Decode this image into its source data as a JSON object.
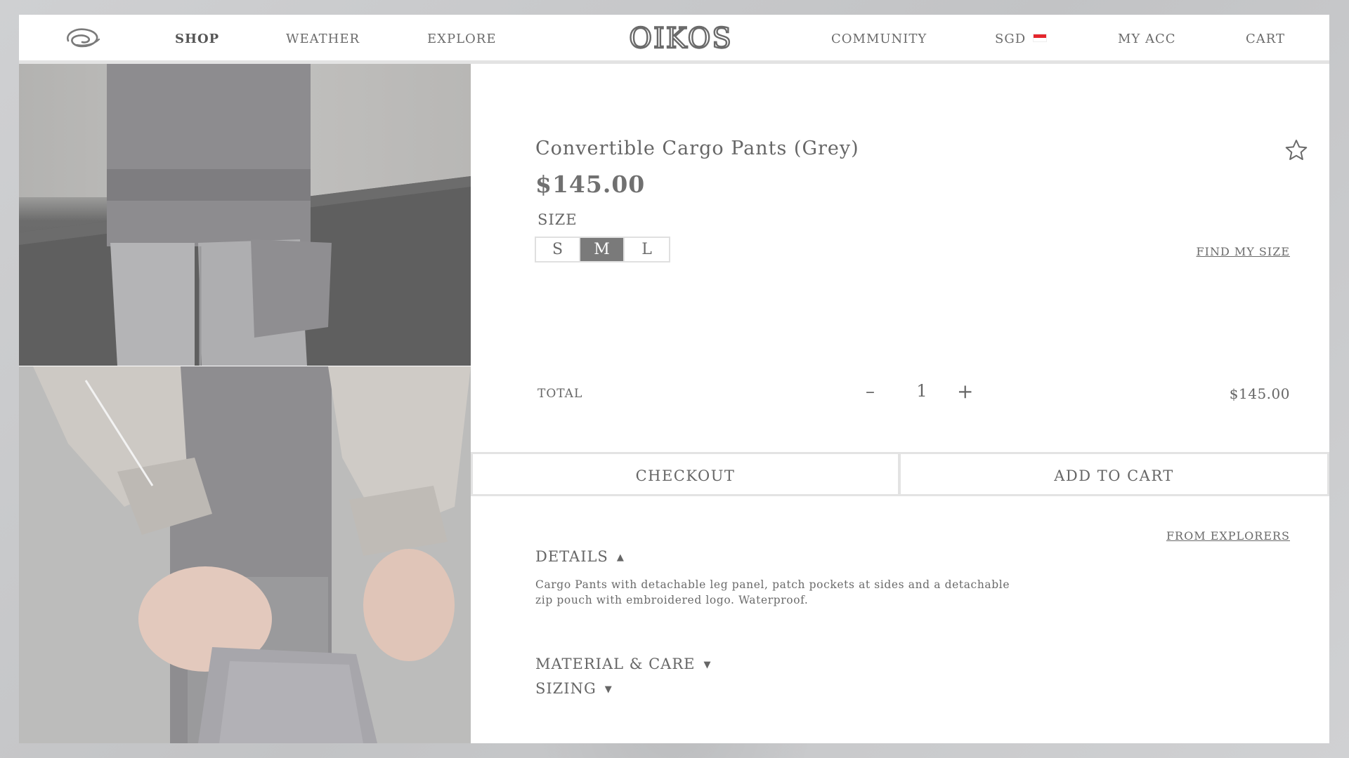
{
  "header": {
    "nav_left": [
      "SHOP",
      "WEATHER",
      "EXPLORE"
    ],
    "active_nav": "SHOP",
    "brand": "OIKOS",
    "nav_right": {
      "community": "COMMUNITY",
      "currency": "SGD",
      "account": "MY ACC",
      "cart": "CART"
    },
    "icons": {
      "logo": "swirl-logo-icon",
      "flag": "singapore-flag-icon"
    },
    "colors": {
      "text": "#6b6b6b",
      "active": "#555555"
    }
  },
  "gallery": {
    "images": [
      {
        "alt": "grey-cargo-pants-back-view",
        "icon": "product-photo"
      },
      {
        "alt": "detaching-leg-panel-closeup",
        "icon": "product-photo"
      }
    ]
  },
  "product": {
    "title": "Convertible Cargo Pants (Grey)",
    "price": "$145.00",
    "wishlist_icon": "star-outline-icon",
    "size": {
      "label": "SIZE",
      "options": [
        "S",
        "M",
        "L"
      ],
      "selected": "M",
      "find_my_size": "FIND MY SIZE"
    },
    "total": {
      "label": "TOTAL",
      "minus": "–",
      "quantity": "1",
      "plus": "+",
      "amount": "$145.00"
    },
    "buttons": {
      "checkout": "CHECKOUT",
      "add_to_cart": "ADD TO CART"
    },
    "from_explorers": "FROM EXPLORERS",
    "accordions": {
      "details": {
        "label": "DETAILS",
        "expanded": true,
        "caret": "▲",
        "text": "Cargo Pants with detachable leg panel, patch pockets at sides and a detachable zip pouch with embroidered logo. Waterproof."
      },
      "material": {
        "label": "MATERIAL & CARE",
        "expanded": false,
        "caret": "▼"
      },
      "sizing": {
        "label": "SIZING",
        "expanded": false,
        "caret": "▼"
      }
    },
    "colors": {
      "selected_size_bg": "#7a7a7a",
      "border": "#e0e0e0"
    }
  }
}
